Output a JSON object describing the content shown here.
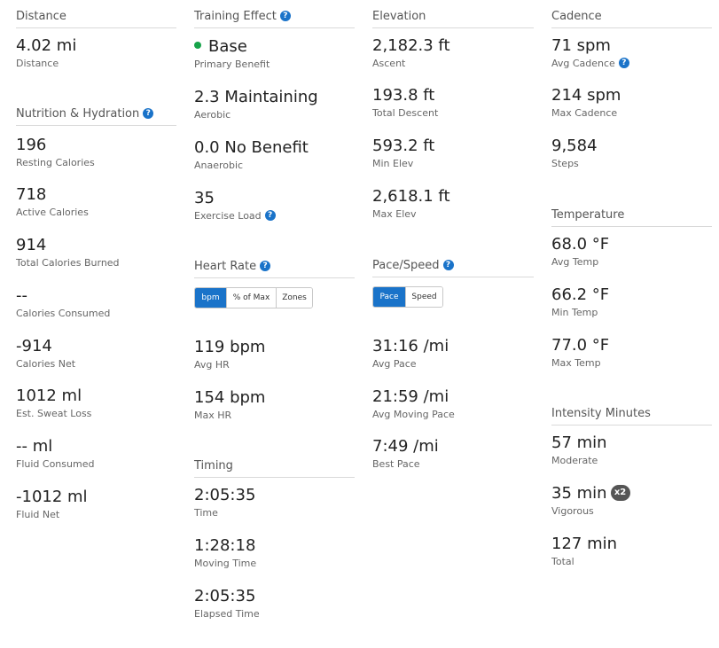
{
  "colors": {
    "accent": "#1a73c9",
    "primary_benefit_dot": "#17a34a",
    "badge": "#555555"
  },
  "distance": {
    "title": "Distance",
    "stats": [
      {
        "value": "4.02 mi",
        "label": "Distance"
      }
    ]
  },
  "nutrition": {
    "title": "Nutrition & Hydration",
    "help_icon": "?",
    "stats": [
      {
        "value": "196",
        "label": "Resting Calories"
      },
      {
        "value": "718",
        "label": "Active Calories"
      },
      {
        "value": "914",
        "label": "Total Calories Burned"
      },
      {
        "value": "--",
        "label": "Calories Consumed"
      },
      {
        "value": "-914",
        "label": "Calories Net"
      },
      {
        "value": "1012 ml",
        "label": "Est. Sweat Loss"
      },
      {
        "value": "-- ml",
        "label": "Fluid Consumed"
      },
      {
        "value": "-1012 ml",
        "label": "Fluid Net"
      }
    ]
  },
  "training_effect": {
    "title": "Training Effect",
    "help_icon": "?",
    "stats": [
      {
        "value": "Base",
        "label": "Primary Benefit"
      },
      {
        "value": "2.3 Maintaining",
        "label": "Aerobic"
      },
      {
        "value": "0.0 No Benefit",
        "label": "Anaerobic"
      },
      {
        "value": "35",
        "label": "Exercise Load",
        "help_icon": "?"
      }
    ]
  },
  "heart_rate": {
    "title": "Heart Rate",
    "help_icon": "?",
    "toggle": [
      "bpm",
      "% of Max",
      "Zones"
    ],
    "active_toggle": "bpm",
    "stats": [
      {
        "value": "119 bpm",
        "label": "Avg HR"
      },
      {
        "value": "154 bpm",
        "label": "Max HR"
      }
    ]
  },
  "timing": {
    "title": "Timing",
    "stats": [
      {
        "value": "2:05:35",
        "label": "Time"
      },
      {
        "value": "1:28:18",
        "label": "Moving Time"
      },
      {
        "value": "2:05:35",
        "label": "Elapsed Time"
      }
    ]
  },
  "elevation": {
    "title": "Elevation",
    "stats": [
      {
        "value": "2,182.3 ft",
        "label": "Ascent"
      },
      {
        "value": "193.8 ft",
        "label": "Total Descent"
      },
      {
        "value": "593.2 ft",
        "label": "Min Elev"
      },
      {
        "value": "2,618.1 ft",
        "label": "Max Elev"
      }
    ]
  },
  "pace_speed": {
    "title": "Pace/Speed",
    "help_icon": "?",
    "toggle": [
      "Pace",
      "Speed"
    ],
    "active_toggle": "Pace",
    "stats": [
      {
        "value": "31:16 /mi",
        "label": "Avg Pace"
      },
      {
        "value": "21:59 /mi",
        "label": "Avg Moving Pace"
      },
      {
        "value": "7:49 /mi",
        "label": "Best Pace"
      }
    ]
  },
  "cadence": {
    "title": "Cadence",
    "stats": [
      {
        "value": "71 spm",
        "label": "Avg Cadence",
        "help_icon": "?"
      },
      {
        "value": "214 spm",
        "label": "Max Cadence"
      },
      {
        "value": "9,584",
        "label": "Steps"
      }
    ]
  },
  "temperature": {
    "title": "Temperature",
    "stats": [
      {
        "value": "68.0 °F",
        "label": "Avg Temp"
      },
      {
        "value": "66.2 °F",
        "label": "Min Temp"
      },
      {
        "value": "77.0 °F",
        "label": "Max Temp"
      }
    ]
  },
  "intensity": {
    "title": "Intensity Minutes",
    "stats": [
      {
        "value": "57 min",
        "label": "Moderate"
      },
      {
        "value": "35 min",
        "label": "Vigorous",
        "badge": "x2"
      },
      {
        "value": "127 min",
        "label": "Total"
      }
    ]
  }
}
